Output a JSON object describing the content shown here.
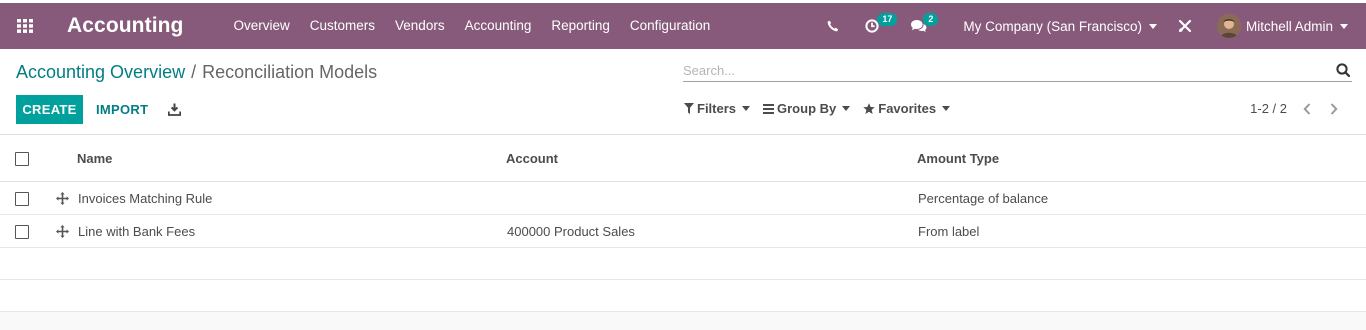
{
  "navbar": {
    "app_title": "Accounting",
    "menu": [
      "Overview",
      "Customers",
      "Vendors",
      "Accounting",
      "Reporting",
      "Configuration"
    ],
    "activity_count": "17",
    "messages_count": "2",
    "company": "My Company (San Francisco)",
    "user": "Mitchell Admin",
    "colors": {
      "bar": "#875a7b",
      "badge": "#00a09d"
    }
  },
  "breadcrumb": {
    "parent": "Accounting Overview",
    "separator": "/",
    "current": "Reconciliation Models"
  },
  "search": {
    "placeholder": "Search..."
  },
  "buttons": {
    "create": "CREATE",
    "import": "IMPORT"
  },
  "filters": {
    "filters": "Filters",
    "group_by": "Group By",
    "favorites": "Favorites"
  },
  "pager": {
    "value": "1-2 / 2"
  },
  "table": {
    "headers": {
      "name": "Name",
      "account": "Account",
      "amount_type": "Amount Type"
    },
    "rows": [
      {
        "name": "Invoices Matching Rule",
        "account": "",
        "amount_type": "Percentage of balance"
      },
      {
        "name": "Line with Bank Fees",
        "account": "400000 Product Sales",
        "amount_type": "From label"
      }
    ]
  }
}
